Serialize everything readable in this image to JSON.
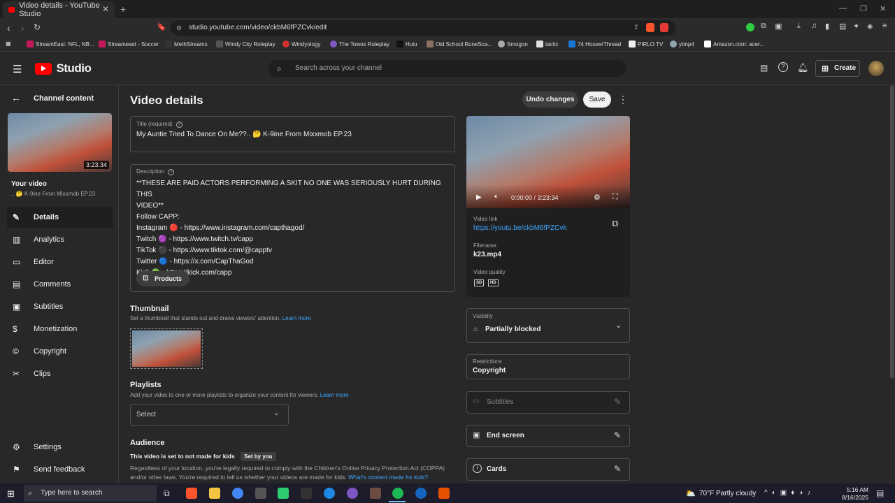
{
  "browser": {
    "tab_title": "Video details - YouTube Studio",
    "url": "studio.youtube.com/video/ckbM6fPZCvk/edit",
    "bookmarks": [
      "StreamEast: NFL, NB...",
      "Streameast - Soccer",
      "MethStreams",
      "Windy City Roleplay",
      "Windyology",
      "The Towns Roleplay",
      "Hulu",
      "Old School RuneSca...",
      "Smogon",
      "tactic",
      "74 HooverThread",
      "PIRLO TV",
      "ytmp4",
      "Amazon.com: acer..."
    ]
  },
  "header": {
    "logo": "Studio",
    "search_placeholder": "Search across your channel",
    "create_label": "Create"
  },
  "sidebar": {
    "back_label": "Channel content",
    "thumb_duration": "3:23:34",
    "your_video_label": "Your video",
    "video_title": "K-9ine From Mixxmob EP.23",
    "items": [
      {
        "label": "Details",
        "icon": "pencil-icon"
      },
      {
        "label": "Analytics",
        "icon": "bar-chart-icon"
      },
      {
        "label": "Editor",
        "icon": "film-icon"
      },
      {
        "label": "Comments",
        "icon": "comment-icon"
      },
      {
        "label": "Subtitles",
        "icon": "subtitles-icon"
      },
      {
        "label": "Monetization",
        "icon": "dollar-icon"
      },
      {
        "label": "Copyright",
        "icon": "copyright-icon"
      },
      {
        "label": "Clips",
        "icon": "scissors-icon"
      }
    ],
    "settings_label": "Settings",
    "feedback_label": "Send feedback"
  },
  "main": {
    "page_title": "Video details",
    "undo_label": "Undo changes",
    "save_label": "Save",
    "title_label": "Title (required)",
    "title_value": "My Auntie Tried To Dance On Me??.. 🤔 K-9ine From Mixxmob EP.23",
    "description_label": "Description",
    "description_lines": [
      "**THESE ARE PAID ACTORS PERFORMING A SKIT NO ONE WAS SERIOUSLY HURT DURING THIS",
      "VIDEO**",
      "Follow CAPP:",
      "Instagram 🔴 - https://www.instagram.com/capthagod/",
      "Twitch 🟣 - https://www.twitch.tv/capp",
      "TikTok ⚫ - https://www.tiktok.com/@capptv",
      "Twitter 🔵 - https://x.com/CapThaGod",
      "Kick 🟢 - https://kick.com/capp"
    ],
    "products_label": "Products",
    "thumbnail_title": "Thumbnail",
    "thumbnail_sub": "Set a thumbnail that stands out and draws viewers' attention.",
    "learn_more": "Learn more",
    "playlists_title": "Playlists",
    "playlists_sub": "Add your video to one or more playlists to organize your content for viewers.",
    "playlist_select": "Select",
    "audience_title": "Audience",
    "audience_status": "This video is set to not made for kids",
    "set_by_you": "Set by you",
    "audience_text_1": "Regardless of your location, you're legally required to comply with the Children's Online Privacy Protection Act (COPPA)",
    "audience_text_2": "and/or other laws. You're required to tell us whether your videos are made for kids.",
    "kids_link": "What's content made for kids?"
  },
  "panel": {
    "time": "0:00:00 / 3:23:34",
    "video_link_label": "Video link",
    "video_link": "https://youtu.be/ckbM6fPZCvk",
    "filename_label": "Filename",
    "filename": "k23.mp4",
    "quality_label": "Video quality",
    "quality_sd": "SD",
    "quality_hd": "HD",
    "visibility_label": "Visibility",
    "visibility_value": "Partially blocked",
    "restrictions_label": "Restrictions",
    "restrictions_value": "Copyright",
    "subtitles_label": "Subtitles",
    "endscreen_label": "End screen",
    "cards_label": "Cards"
  },
  "taskbar": {
    "search_placeholder": "Type here to search",
    "weather": "70°F  Partly cloudy",
    "time": "5:16 AM",
    "date": "8/16/2025"
  }
}
